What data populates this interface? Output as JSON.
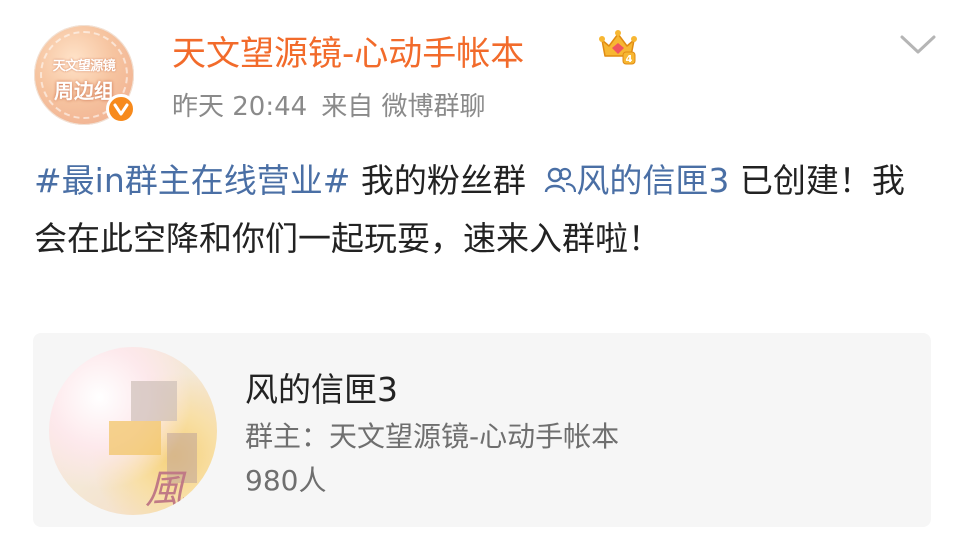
{
  "author": {
    "avatar_line1": "天文望源镜",
    "avatar_line2": "周边组",
    "name": "天文望源镜-心动手帐本",
    "verified_color": "#f78a1c",
    "vip_icon": "crown-badge-icon"
  },
  "meta": {
    "time": "昨天 20:44",
    "source": "来自 微博群聊"
  },
  "post": {
    "hashtag": "#最in群主在线营业#",
    "text_before_link": " 我的粉丝群 ",
    "group_link": "风的信匣3",
    "text_after_link": " 已创建！我会在此空降和你们一起玩耍，速来入群啦！"
  },
  "group_card": {
    "title": "风的信匣3",
    "owner": "群主：天文望源镜-心动手帐本",
    "members": "980人",
    "cover_glyph": "風"
  },
  "colors": {
    "username": "#f26b2b",
    "link": "#4a6fa5",
    "meta": "#8a8a8a",
    "card_bg": "#f6f6f6"
  }
}
